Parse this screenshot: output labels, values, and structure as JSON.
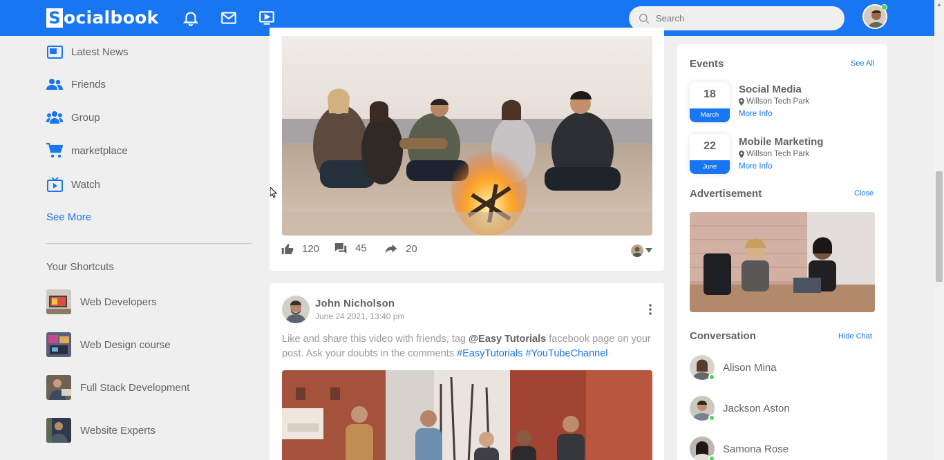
{
  "navbar": {
    "logo_letter": "S",
    "logo_text": "ocialbook",
    "search_placeholder": "Search",
    "icons": [
      "bell-icon",
      "mail-icon",
      "video-icon",
      "search-icon"
    ],
    "colors": {
      "brand": "#1876f2",
      "online": "#41db51"
    }
  },
  "left": {
    "links": [
      {
        "label": "Latest News",
        "icon": "news-icon"
      },
      {
        "label": "Friends",
        "icon": "friends-icon"
      },
      {
        "label": "Group",
        "icon": "group-icon"
      },
      {
        "label": "marketplace",
        "icon": "cart-icon"
      },
      {
        "label": "Watch",
        "icon": "tv-icon"
      }
    ],
    "see_more": "See More",
    "shortcuts_title": "Your Shortcuts",
    "shortcuts": [
      {
        "label": "Web Developers"
      },
      {
        "label": "Web Design course"
      },
      {
        "label": "Full Stack Development"
      },
      {
        "label": "Website Experts"
      }
    ]
  },
  "feed": {
    "post1": {
      "likes": "120",
      "comments": "45",
      "shares": "20"
    },
    "post2": {
      "author": "John Nicholson",
      "date": "June 24 2021, 13:40 pm",
      "text_a": "Like and share this video with friends, tag ",
      "tag": "@Easy Tutorials",
      "text_b": " facebook page on your post. Ask your doubts in the comments ",
      "hashtags": "#EasyTutorials #YouTubeChannel"
    }
  },
  "right": {
    "events": {
      "title": "Events",
      "see_all": "See All",
      "items": [
        {
          "day": "18",
          "month": "March",
          "title": "Social Media",
          "location": "Willson Tech Park",
          "more": "More Info"
        },
        {
          "day": "22",
          "month": "June",
          "title": "Mobile Marketing",
          "location": "Willson Tech Park",
          "more": "More Info"
        }
      ]
    },
    "ad": {
      "title": "Advertisement",
      "close": "Close"
    },
    "conversation": {
      "title": "Conversation",
      "hide": "Hide Chat",
      "people": [
        {
          "name": "Alison Mina"
        },
        {
          "name": "Jackson Aston"
        },
        {
          "name": "Samona Rose"
        }
      ]
    }
  }
}
